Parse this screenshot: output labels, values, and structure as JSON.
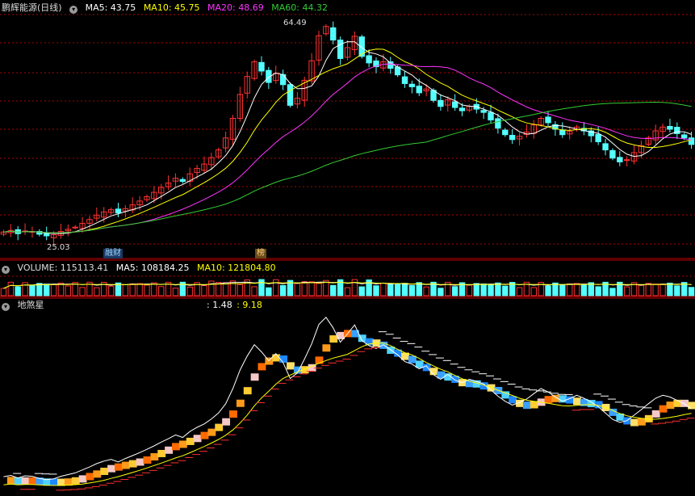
{
  "main_header": {
    "stock_name": "鹏辉能源(日线)",
    "indicators": [
      {
        "label": "MA5: 43.75",
        "color": "#ffffff"
      },
      {
        "label": "MA10: 45.75",
        "color": "#ffff00"
      },
      {
        "label": "MA20: 48.69",
        "color": "#ff33ff"
      },
      {
        "label": "MA60: 44.32",
        "color": "#33cc33"
      }
    ]
  },
  "annotations": {
    "high_label": "64.49",
    "low_label": "25.03",
    "event_tag_1": "融财",
    "event_tag_2": "榜"
  },
  "volume_header": {
    "volume": "VOLUME: 115113.41",
    "ma5": "MA5: 108184.25",
    "ma10": "MA10: 121804.80"
  },
  "indicator_header": {
    "name": "地煞星",
    "value1": ": 1.48",
    "value2": ": 9.18"
  },
  "colors": {
    "up": "#ff3232",
    "down": "#54ffff",
    "grid": "#b00000",
    "ma5": "#ffffff",
    "ma10": "#ffff00",
    "ma20": "#ff33ff",
    "ma60": "#33cc33",
    "divider": "#c00000"
  },
  "chart_data": {
    "type": "candlestick",
    "title": "鹏辉能源(日线)",
    "price_high": 64.49,
    "price_low": 25.03,
    "ma_values": {
      "MA5": 43.75,
      "MA10": 45.75,
      "MA20": 48.69,
      "MA60": 44.32
    },
    "close_series": [
      25.9,
      26.2,
      25.6,
      26.1,
      26.0,
      25.5,
      25.2,
      25.4,
      26.0,
      26.4,
      26.8,
      27.5,
      28.2,
      29.0,
      29.6,
      30.0,
      29.4,
      30.2,
      30.9,
      31.6,
      32.4,
      33.2,
      34.1,
      34.9,
      35.8,
      35.2,
      36.6,
      37.6,
      38.4,
      39.6,
      41.0,
      43.2,
      46.8,
      51.2,
      54.5,
      57.2,
      55.5,
      53.4,
      55.1,
      53.0,
      49.2,
      50.5,
      53.8,
      57.4,
      62.0,
      63.7,
      61.2,
      57.8,
      59.8,
      61.9,
      58.2,
      57.0,
      56.3,
      57.2,
      56.0,
      54.8,
      53.2,
      52.6,
      51.5,
      52.2,
      50.1,
      49.0,
      50.2,
      48.8,
      48.2,
      49.0,
      48.5,
      47.9,
      46.5,
      45.0,
      43.8,
      42.9,
      43.5,
      44.3,
      45.6,
      46.8,
      46.0,
      44.8,
      43.8,
      44.4,
      45.2,
      44.5,
      43.6,
      42.5,
      41.0,
      39.5,
      38.8,
      39.2,
      40.5,
      41.8,
      43.2,
      44.5,
      45.2,
      44.8,
      44.0,
      43.2,
      42.0
    ],
    "volume": {
      "value": 115113.41,
      "MA5": 108184.25,
      "MA10": 121804.8
    },
    "indicator": {
      "name": "地煞星",
      "values": [
        1.48,
        9.18
      ]
    }
  }
}
